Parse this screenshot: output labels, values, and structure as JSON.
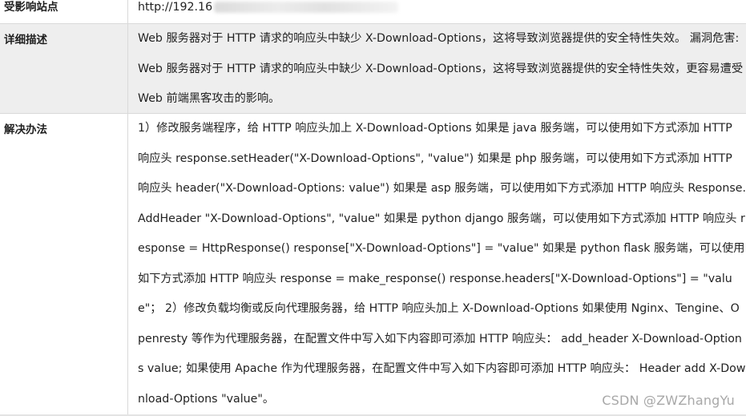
{
  "rows": {
    "site": {
      "label": "受影响站点",
      "value": "http://192.16"
    },
    "detail": {
      "label": "详细描述",
      "value": "Web 服务器对于 HTTP 请求的响应头中缺少 X-Download-Options，这将导致浏览器提供的安全特性失效。 漏洞危害: Web 服务器对于 HTTP 请求的响应头中缺少 X-Download-Options，这将导致浏览器提供的安全特性失效，更容易遭受 Web 前端黑客攻击的影响。"
    },
    "solution": {
      "label": "解决办法",
      "value": "1）修改服务端程序，给 HTTP 响应头加上 X-Download-Options 如果是 java 服务端，可以使用如下方式添加 HTTP 响应头 response.setHeader(\"X-Download-Options\", \"value\") 如果是 php 服务端，可以使用如下方式添加 HTTP 响应头 header(\"X-Download-Options: value\") 如果是 asp 服务端，可以使用如下方式添加 HTTP 响应头 Response.AddHeader \"X-Download-Options\", \"value\" 如果是 python django 服务端，可以使用如下方式添加 HTTP 响应头 response = HttpResponse() response[\"X-Download-Options\"] = \"value\" 如果是 python flask 服务端，可以使用如下方式添加 HTTP 响应头 response = make_response() response.headers[\"X-Download-Options\"] = \"value\"； 2）修改负载均衡或反向代理服务器，给 HTTP 响应头加上 X-Download-Options 如果使用 Nginx、Tengine、Openresty 等作为代理服务器，在配置文件中写入如下内容即可添加 HTTP 响应头： add_header X-Download-Options value; 如果使用 Apache 作为代理服务器，在配置文件中写入如下内容即可添加 HTTP 响应头： Header add X-Download-Options \"value\"。"
    }
  },
  "watermark": "CSDN @ZWZhangYu"
}
